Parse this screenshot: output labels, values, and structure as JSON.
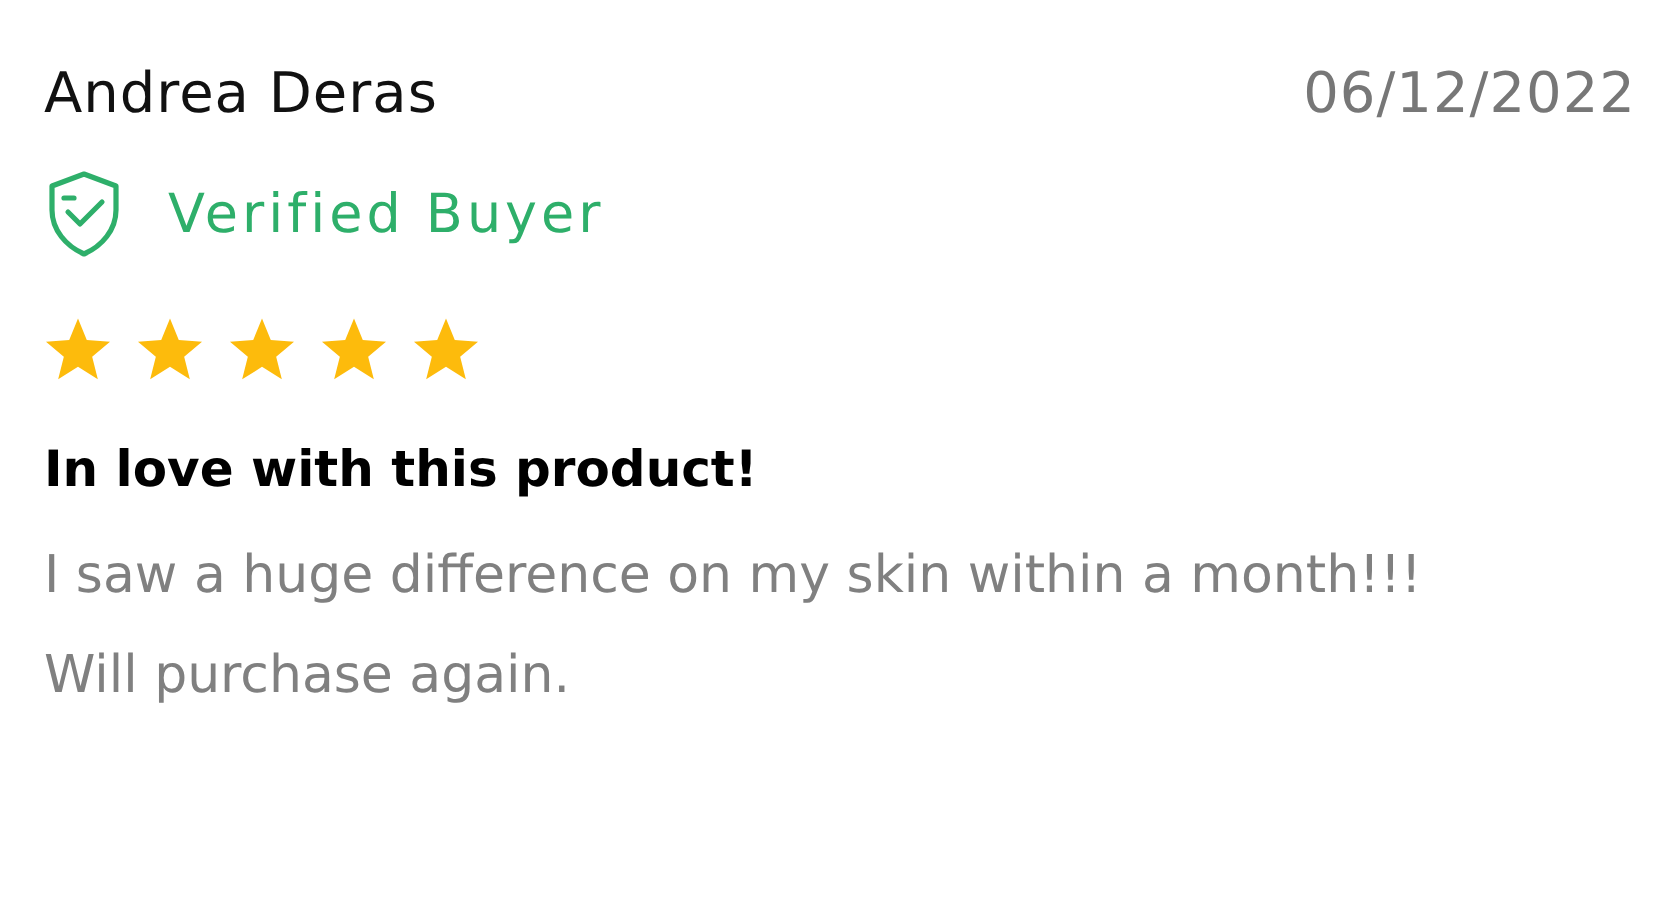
{
  "review": {
    "author": "Andrea Deras",
    "date": "06/12/2022",
    "verified_label": "Verified Buyer",
    "stars": 5,
    "title": "In love with this product!",
    "body": "I saw a huge difference on my skin within a month!!! Will purchase again."
  }
}
